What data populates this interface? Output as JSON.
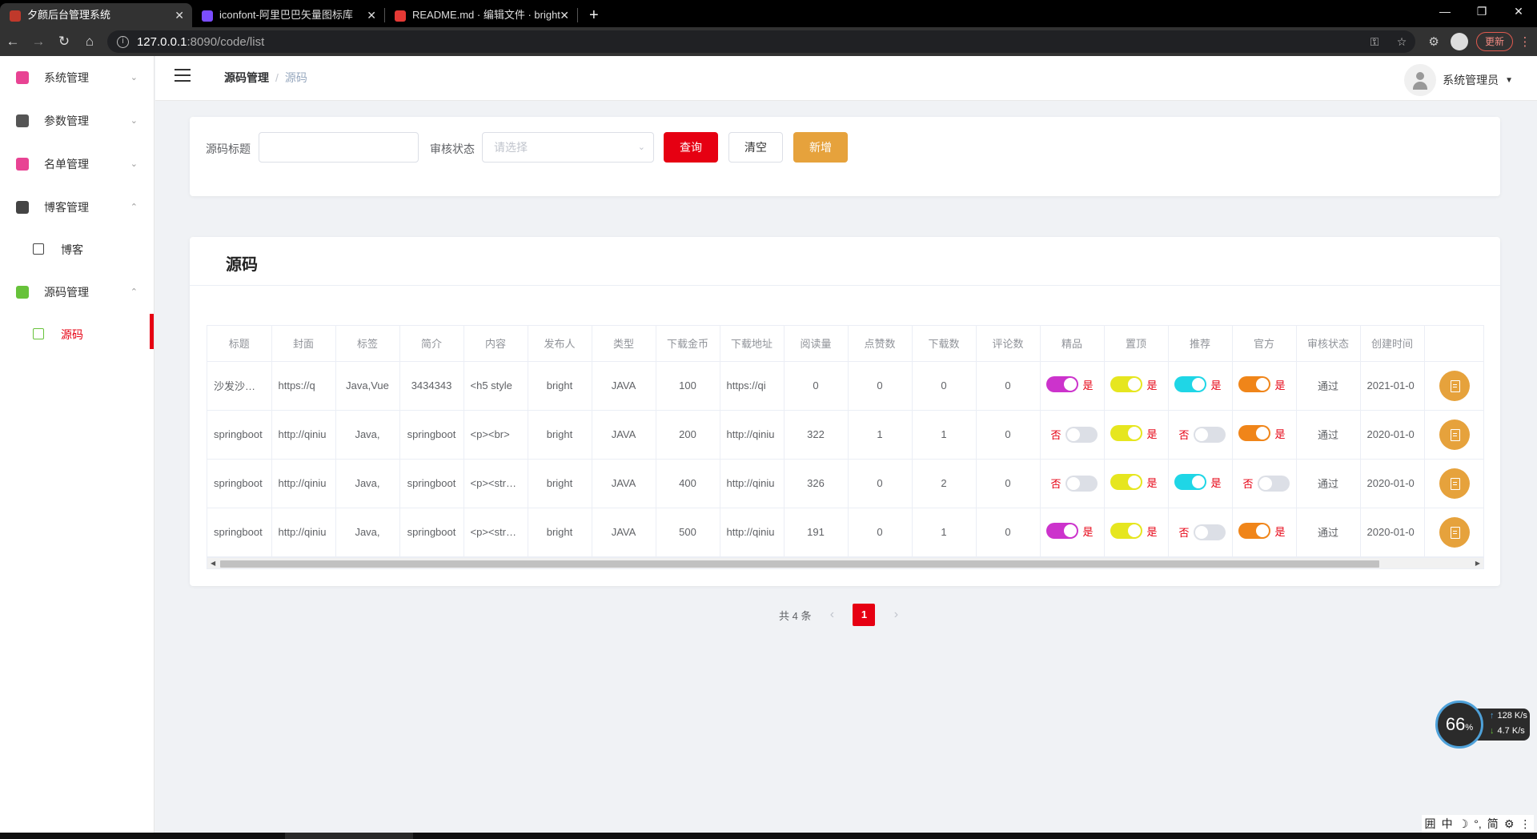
{
  "browser": {
    "tabs": [
      {
        "title": "夕颜后台管理系统",
        "active": true,
        "favicon_color": "#c0392b"
      },
      {
        "title": "iconfont-阿里巴巴矢量图标库",
        "active": false,
        "favicon_color": "#7b4dff"
      },
      {
        "title": "README.md · 编辑文件 · bright",
        "active": false,
        "favicon_color": "#e53935"
      }
    ],
    "url_host": "127.0.0.1",
    "url_path": ":8090/code/list",
    "update_label": "更新"
  },
  "sidebar": {
    "items": [
      {
        "label": "系统管理",
        "icon": "gear-icon",
        "color": "#e84393",
        "expanded": false
      },
      {
        "label": "参数管理",
        "icon": "paper-plane-icon",
        "color": "#555555",
        "expanded": false
      },
      {
        "label": "名单管理",
        "icon": "list-icon",
        "color": "#e84393",
        "expanded": false
      },
      {
        "label": "博客管理",
        "icon": "notebook-icon",
        "color": "#444444",
        "expanded": true,
        "children": [
          {
            "label": "博客",
            "active": false
          }
        ]
      },
      {
        "label": "源码管理",
        "icon": "code-icon",
        "color": "#67c23a",
        "expanded": true,
        "children": [
          {
            "label": "源码",
            "active": true
          }
        ]
      }
    ]
  },
  "navbar": {
    "breadcrumb": [
      "源码管理",
      "源码"
    ],
    "user": "系统管理员"
  },
  "filter": {
    "title_label": "源码标题",
    "title_value": "",
    "status_label": "审核状态",
    "status_placeholder": "请选择",
    "search_button": "查询",
    "clear_button": "清空",
    "add_button": "新增"
  },
  "table": {
    "card_title": "源码",
    "columns": [
      "标题",
      "封面",
      "标签",
      "简介",
      "内容",
      "发布人",
      "类型",
      "下载金币",
      "下载地址",
      "阅读量",
      "点赞数",
      "下载数",
      "评论数",
      "精品",
      "置顶",
      "推荐",
      "官方",
      "审核状态",
      "创建时间",
      ""
    ],
    "rows": [
      {
        "title": "沙发沙发沙发",
        "cover": "https://q",
        "tags": "Java,Vue",
        "summary": "3434343",
        "content": "<h5 style",
        "author": "bright",
        "type": "JAVA",
        "coins": "100",
        "url": "https://qi",
        "reads": "0",
        "likes": "0",
        "downloads": "0",
        "comments": "0",
        "status": "通过",
        "created": "2021-01-0",
        "switches": [
          {
            "on": true,
            "text": "是",
            "color": "#cc33cc"
          },
          {
            "on": true,
            "text": "是",
            "color": "#e6e61f"
          },
          {
            "on": true,
            "text": "是",
            "color": "#1fd6e6"
          },
          {
            "on": true,
            "text": "是",
            "color": "#f08519"
          }
        ]
      },
      {
        "title": "springboot",
        "cover": "http://qiniu",
        "tags": "Java,",
        "summary": "springboot",
        "content": "<p><br>",
        "author": "bright",
        "type": "JAVA",
        "coins": "200",
        "url": "http://qiniu",
        "reads": "322",
        "likes": "1",
        "downloads": "1",
        "comments": "0",
        "status": "通过",
        "created": "2020-01-0",
        "switches": [
          {
            "on": false,
            "text": "否",
            "color": "#cc33cc"
          },
          {
            "on": true,
            "text": "是",
            "color": "#e6e61f"
          },
          {
            "on": false,
            "text": "否",
            "color": "#1fd6e6"
          },
          {
            "on": true,
            "text": "是",
            "color": "#f08519"
          }
        ]
      },
      {
        "title": "springboot",
        "cover": "http://qiniu",
        "tags": "Java,",
        "summary": "springboot",
        "content": "<p><strong>",
        "author": "bright",
        "type": "JAVA",
        "coins": "400",
        "url": "http://qiniu",
        "reads": "326",
        "likes": "0",
        "downloads": "2",
        "comments": "0",
        "status": "通过",
        "created": "2020-01-0",
        "switches": [
          {
            "on": false,
            "text": "否",
            "color": "#cc33cc"
          },
          {
            "on": true,
            "text": "是",
            "color": "#e6e61f"
          },
          {
            "on": true,
            "text": "是",
            "color": "#1fd6e6"
          },
          {
            "on": false,
            "text": "否",
            "color": "#f08519"
          }
        ]
      },
      {
        "title": "springboot",
        "cover": "http://qiniu",
        "tags": "Java,",
        "summary": "springboot",
        "content": "<p><strong>",
        "author": "bright",
        "type": "JAVA",
        "coins": "500",
        "url": "http://qiniu",
        "reads": "191",
        "likes": "0",
        "downloads": "1",
        "comments": "0",
        "status": "通过",
        "created": "2020-01-0",
        "switches": [
          {
            "on": true,
            "text": "是",
            "color": "#cc33cc"
          },
          {
            "on": true,
            "text": "是",
            "color": "#e6e61f"
          },
          {
            "on": false,
            "text": "否",
            "color": "#1fd6e6"
          },
          {
            "on": true,
            "text": "是",
            "color": "#f08519"
          }
        ]
      }
    ]
  },
  "pagination": {
    "total_text": "共 4 条",
    "current_page": "1"
  },
  "network_widget": {
    "percent": "66",
    "percent_unit": "%",
    "up": "128",
    "down": "4.7",
    "unit": "K/s"
  },
  "ime": [
    "囲",
    "中",
    "☽",
    "°,",
    "简",
    "⚙",
    "⋮"
  ]
}
